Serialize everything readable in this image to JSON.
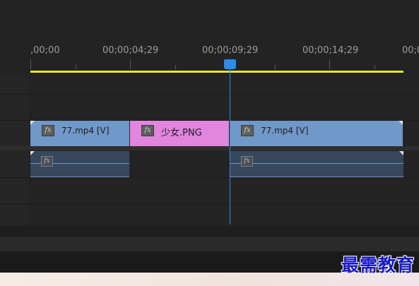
{
  "ruler": {
    "timecodes": [
      ",00;00",
      "00;00;04;29",
      "00;00;09;29",
      "00;00;14;29",
      "00;0"
    ]
  },
  "video_track": {
    "clips": [
      {
        "label": "77.mp4 [V]",
        "type": "video",
        "color": "#7098c9"
      },
      {
        "label": "少女.PNG",
        "type": "image",
        "color": "#e285de"
      },
      {
        "label": "77.mp4 [V]",
        "type": "video",
        "color": "#7098c9"
      }
    ],
    "fx_label": "fx"
  },
  "audio_track": {
    "fx_label": "fx"
  },
  "colors": {
    "background": "#232323",
    "work_area_bar": "#e8e33a",
    "playhead": "#2d8ceb",
    "video_clip": "#7098c9",
    "image_clip": "#e285de",
    "audio_clip": "#37475d"
  },
  "watermark": {
    "text": "最需教育"
  }
}
